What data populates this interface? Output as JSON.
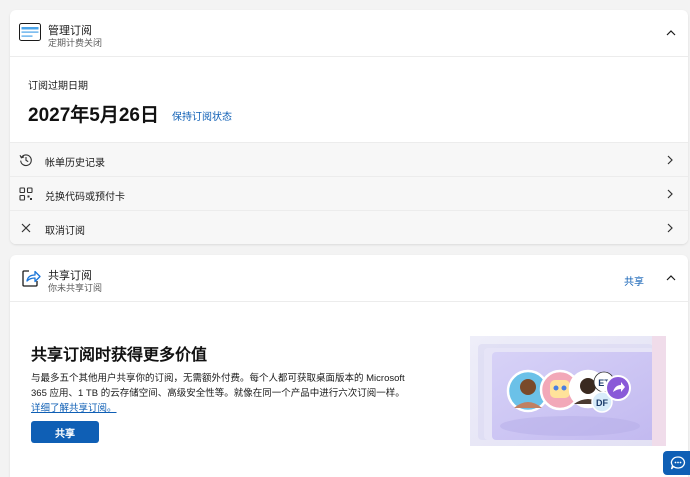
{
  "manage": {
    "title": "管理订阅",
    "subtitle": "定期计费关闭",
    "expiry_label": "订阅过期日期",
    "expiry_date": "2027年5月26日",
    "keep_link": "保持订阅状态",
    "rows": [
      {
        "label": "帐单历史记录",
        "icon": "history-icon"
      },
      {
        "label": "兑换代码或预付卡",
        "icon": "qr-code-icon"
      },
      {
        "label": "取消订阅",
        "icon": "close-icon"
      }
    ]
  },
  "share": {
    "title": "共享订阅",
    "subtitle": "你未共享订阅",
    "header_action": "共享",
    "heading": "共享订阅时获得更多价值",
    "description": "与最多五个其他用户共享你的订阅，无需额外付费。每个人都可获取桌面版本的 Microsoft 365 应用、1 TB 的云存储空间、高级安全性等。就像在同一个产品中进行六次订阅一样。",
    "learn_more": "详细了解共享订阅。",
    "button": "共享",
    "illustration_badges": [
      "ET",
      "DF"
    ]
  },
  "colors": {
    "accent": "#0f5fb5",
    "background": "#f3f3f3",
    "card": "#ffffff"
  }
}
